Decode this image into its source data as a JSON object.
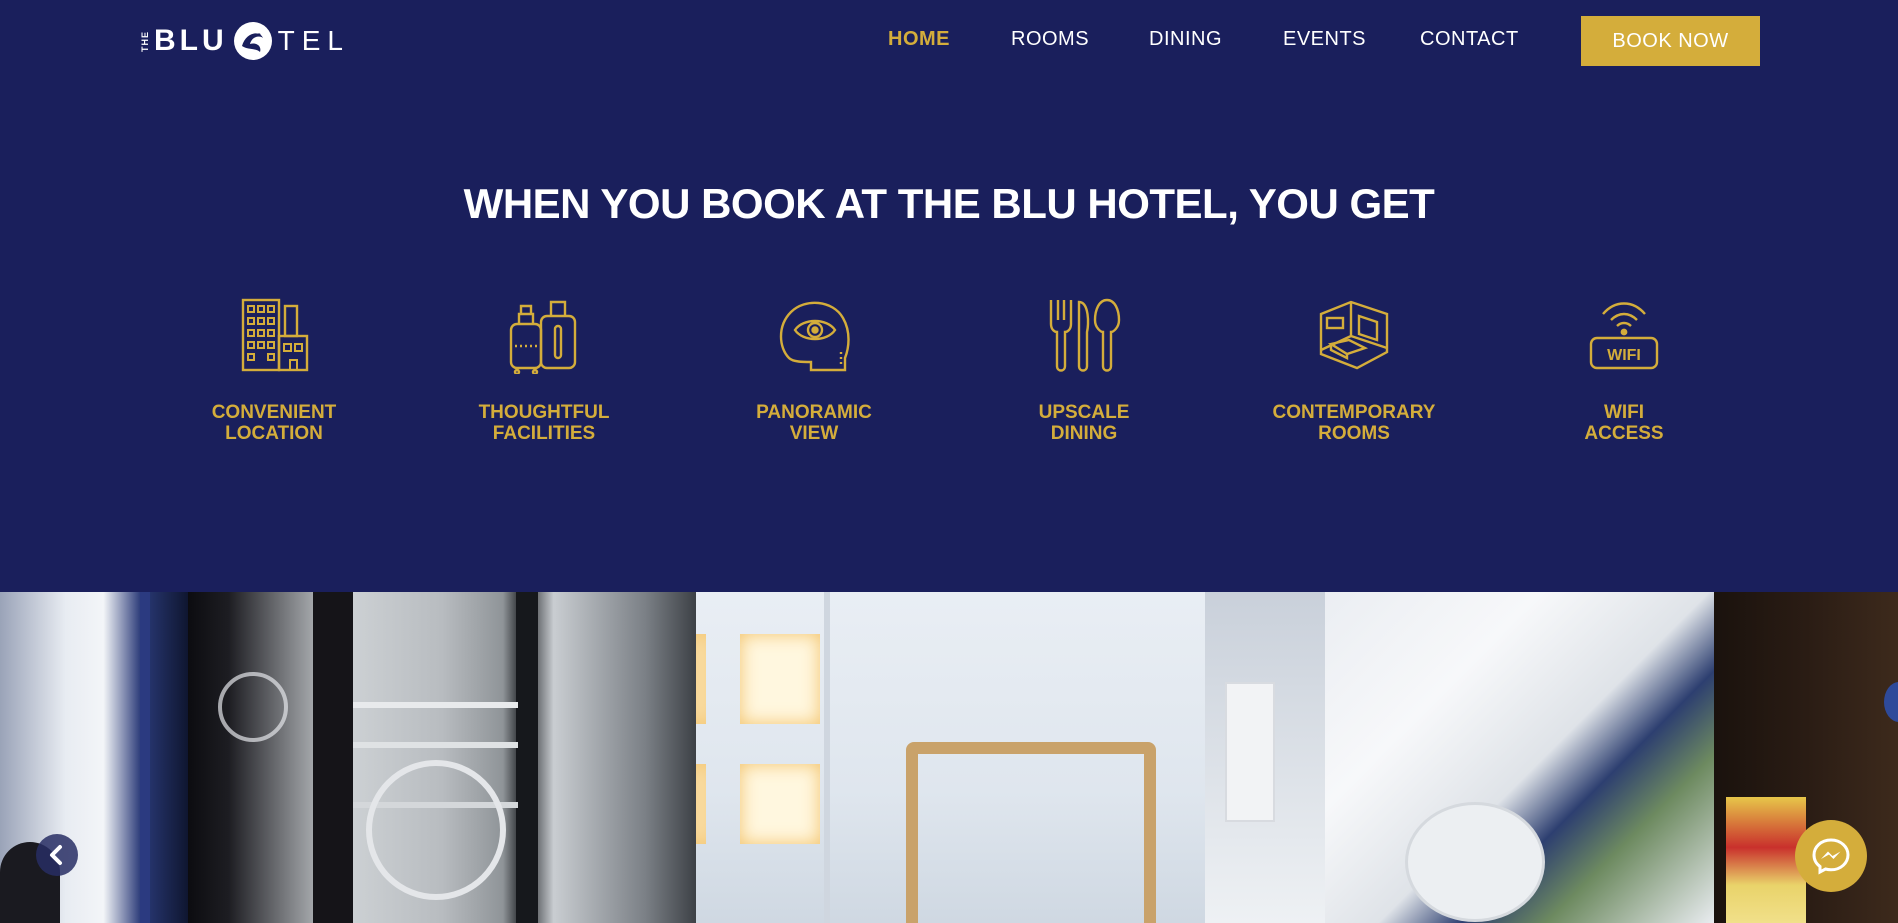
{
  "header": {
    "logo": {
      "the": "THE",
      "blu": "BLU",
      "tel": "TEL"
    },
    "nav": [
      {
        "label": "HOME",
        "active": true
      },
      {
        "label": "ROOMS",
        "active": false
      },
      {
        "label": "DINING",
        "active": false
      },
      {
        "label": "EVENTS",
        "active": false
      },
      {
        "label": "CONTACT",
        "active": false
      }
    ],
    "book_label": "BOOK NOW"
  },
  "main": {
    "heading": "WHEN YOU BOOK AT THE BLU HOTEL, YOU GET",
    "features": [
      {
        "icon": "building-icon",
        "label": "CONVENIENT\nLOCATION"
      },
      {
        "icon": "luggage-icon",
        "label": "THOUGHTFUL\nFACILITIES"
      },
      {
        "icon": "eye-head-icon",
        "label": "PANORAMIC\nVIEW"
      },
      {
        "icon": "cutlery-icon",
        "label": "UPSCALE\nDINING"
      },
      {
        "icon": "room-icon",
        "label": "CONTEMPORARY\nROOMS"
      },
      {
        "icon": "wifi-icon",
        "label": "WIFI\nACCESS"
      }
    ]
  },
  "gallery": {
    "prev_icon": "chevron-left-icon",
    "chat_icon": "messenger-icon"
  },
  "colors": {
    "background": "#1a1f5c",
    "accent": "#d4ad3b",
    "text": "#ffffff"
  }
}
